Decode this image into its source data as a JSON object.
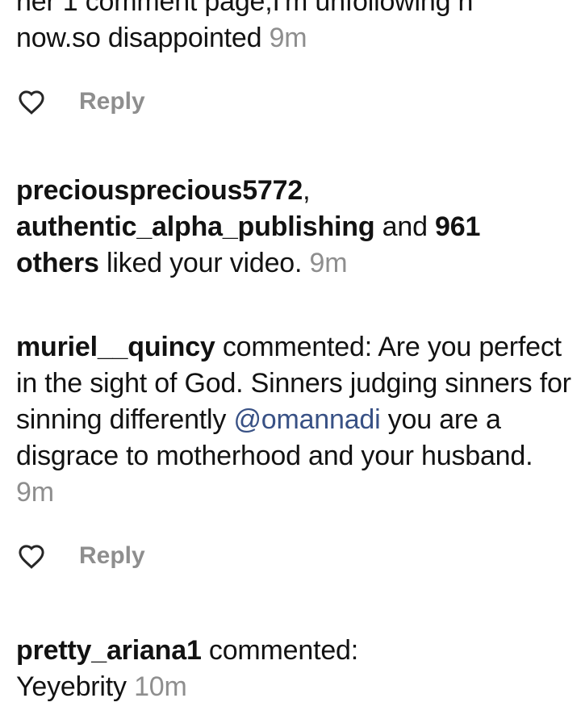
{
  "items": [
    {
      "type": "comment",
      "line1": "her 1 comment page,I'm unfollowing h",
      "line2": "now.so disappointed",
      "time": "9m",
      "reply_label": "Reply"
    },
    {
      "type": "like",
      "user1": "preciousprecious5772",
      "sep": ",",
      "user2": "authentic_alpha_publishing",
      "and": " and ",
      "count": "961",
      "others": "others",
      "text": " liked your video.",
      "time": "9m"
    },
    {
      "type": "comment",
      "user": "muriel__quincy",
      "verb": " commented: ",
      "text_a": "Are you perfect in the sight of God. Sinners judging sinners for sinning differently ",
      "mention": "@omannadi",
      "text_b": " you are a disgrace to motherhood and your husband.",
      "time": "9m",
      "reply_label": "Reply"
    },
    {
      "type": "comment",
      "user": "pretty_ariana1",
      "verb": " commented: ",
      "text": "Yeyebrity",
      "time": "10m"
    }
  ]
}
